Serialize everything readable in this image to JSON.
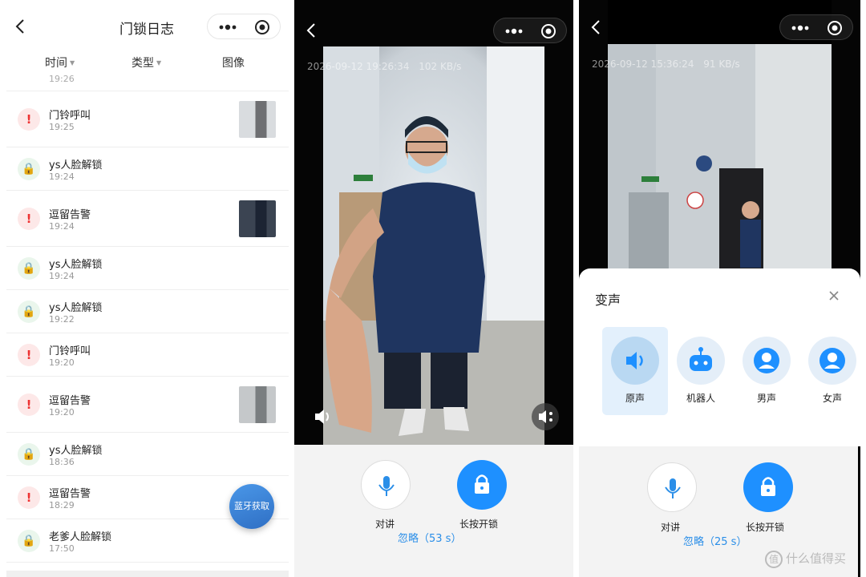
{
  "log": {
    "title": "门锁日志",
    "filters": {
      "time": "时间",
      "type": "类型",
      "image": "图像"
    },
    "cut_time": "19:26",
    "entries": [
      {
        "kind": "alert",
        "title": "门铃呼叫",
        "time": "19:25",
        "thumb": "hallway-light"
      },
      {
        "kind": "lock",
        "title": "ys人脸解锁",
        "time": "19:24"
      },
      {
        "kind": "alert",
        "title": "逗留告警",
        "time": "19:24",
        "thumb": "person-dark"
      },
      {
        "kind": "lock",
        "title": "ys人脸解锁",
        "time": "19:24"
      },
      {
        "kind": "lock",
        "title": "ys人脸解锁",
        "time": "19:22"
      },
      {
        "kind": "alert",
        "title": "门铃呼叫",
        "time": "19:20"
      },
      {
        "kind": "alert",
        "title": "逗留告警",
        "time": "19:20",
        "thumb": "hallway-gray"
      },
      {
        "kind": "lock",
        "title": "ys人脸解锁",
        "time": "18:36"
      },
      {
        "kind": "alert",
        "title": "逗留告警",
        "time": "18:29"
      },
      {
        "kind": "lock",
        "title": "老爹人脸解锁",
        "time": "17:50"
      }
    ],
    "fab_label": "蓝牙获取"
  },
  "call": {
    "timestamp": "2026-09-12 19:26:34",
    "rate": "102 KB/s",
    "talk_label": "对讲",
    "unlock_label": "长按开锁",
    "ignore_label": "忽略（53 s）"
  },
  "voice": {
    "timestamp": "2026-09-12 15:36:24",
    "rate": "91 KB/s",
    "sheet_title": "变声",
    "options": [
      {
        "label": "原声",
        "icon": "speaker-icon",
        "selected": true
      },
      {
        "label": "机器人",
        "icon": "robot-icon",
        "selected": false
      },
      {
        "label": "男声",
        "icon": "person-icon",
        "selected": false
      },
      {
        "label": "女声",
        "icon": "person-icon",
        "selected": false
      }
    ],
    "talk_label": "对讲",
    "unlock_label": "长按开锁",
    "ignore_label": "忽略（25 s）",
    "watermark": "什么值得买",
    "watermark_logo": "值"
  },
  "colors": {
    "accent": "#1e90ff",
    "alert": "#e33333",
    "lock": "#d79a12"
  },
  "icons": {
    "alert": "!",
    "lock": "🔒"
  }
}
